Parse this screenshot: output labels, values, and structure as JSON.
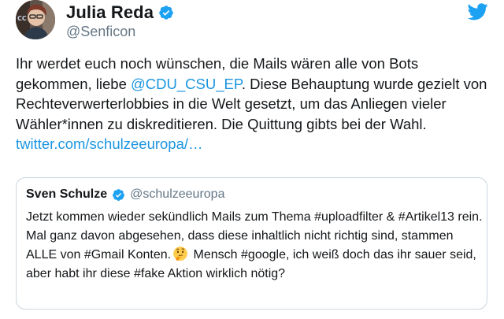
{
  "author": {
    "display_name": "Julia Reda",
    "handle": "@Senficon",
    "verified_icon": "verified-badge-icon",
    "avatar_icon": "avatar-photo"
  },
  "tweet": {
    "text_part1": "Ihr werdet euch noch wünschen, die Mails wären alle von Bots gekommen, liebe ",
    "mention": "@CDU_CSU_EP",
    "text_part2": ". Diese Behauptung wurde gezielt von Rechteverwerterlobbies in die Welt gesetzt, um das Anliegen vieler Wähler*innen zu diskreditieren. Die Quittung gibts bei der Wahl. ",
    "link": "twitter.com/schulzeeuropa/…"
  },
  "quoted": {
    "display_name": "Sven Schulze",
    "handle": "@schulzeeuropa",
    "text_part1": "Jetzt kommen wieder sekündlich Mails zum Thema #uploadfilter & #Artikel13 rein. Mal ganz davon abgesehen, dass diese inhaltlich nicht richtig sind, stammen ALLE von #Gmail Konten.",
    "emoji": "thinking-face-emoji",
    "text_part2": " Mensch #google, ich weiß doch das ihr sauer seid, aber habt ihr diese #fake Aktion wirklich nötig?"
  },
  "colors": {
    "link": "#1b95e0",
    "verified": "#1da1f2",
    "secondary_text": "#657786",
    "border": "#ccd6dd"
  }
}
